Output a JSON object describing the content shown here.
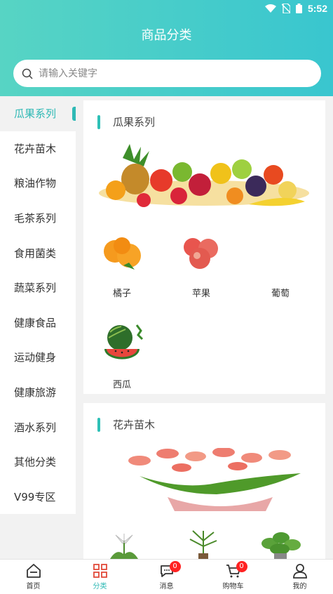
{
  "status": {
    "time": "5:52"
  },
  "header": {
    "title": "商品分类"
  },
  "search": {
    "placeholder": "请输入关键字"
  },
  "sidebar": {
    "items": [
      {
        "label": "瓜果系列",
        "active": true
      },
      {
        "label": "花卉苗木",
        "active": false
      },
      {
        "label": "粮油作物",
        "active": false
      },
      {
        "label": "毛茶系列",
        "active": false
      },
      {
        "label": "食用菌类",
        "active": false
      },
      {
        "label": "蔬菜系列",
        "active": false
      },
      {
        "label": "健康食品",
        "active": false
      },
      {
        "label": "运动健身",
        "active": false
      },
      {
        "label": "健康旅游",
        "active": false
      },
      {
        "label": "酒水系列",
        "active": false
      },
      {
        "label": "其他分类",
        "active": false
      },
      {
        "label": "V99专区",
        "active": false
      }
    ]
  },
  "sections": [
    {
      "title": "瓜果系列",
      "products": [
        {
          "name": "橘子",
          "icon": "orange-image"
        },
        {
          "name": "苹果",
          "icon": "apple-image"
        },
        {
          "name": "葡萄",
          "icon": "grape-image"
        },
        {
          "name": "西瓜",
          "icon": "watermelon-image"
        }
      ]
    },
    {
      "title": "花卉苗木"
    }
  ],
  "tabbar": {
    "items": [
      {
        "label": "首页",
        "icon": "home-icon"
      },
      {
        "label": "分类",
        "icon": "category-icon",
        "active": true
      },
      {
        "label": "消息",
        "icon": "message-icon",
        "badge": "0"
      },
      {
        "label": "购物车",
        "icon": "cart-icon",
        "badge": "0"
      },
      {
        "label": "我的",
        "icon": "profile-icon"
      }
    ]
  },
  "colors": {
    "accent": "#2fb9b5",
    "header_start": "#57d4c4",
    "header_end": "#39c6cf",
    "badge": "#ff2222"
  }
}
